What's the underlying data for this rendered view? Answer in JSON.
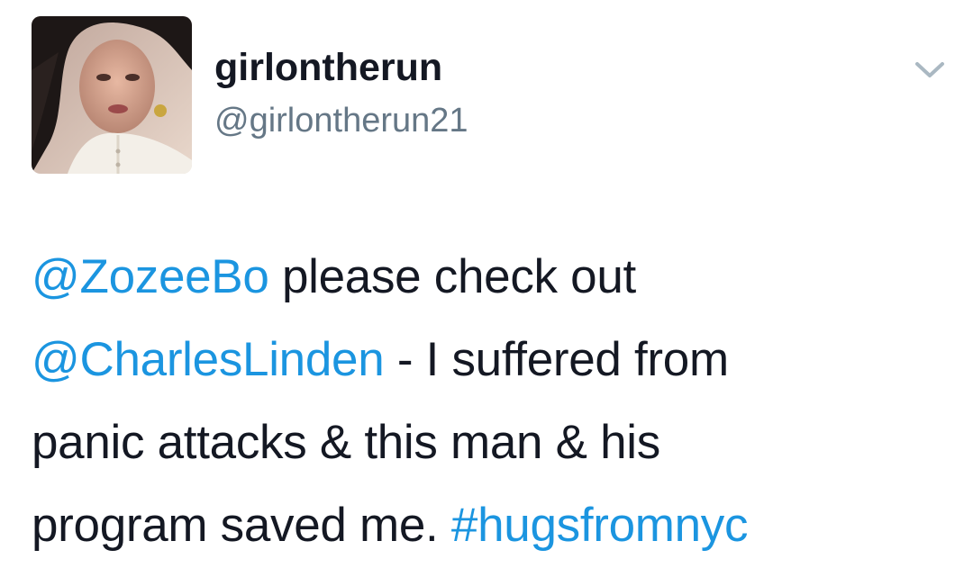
{
  "tweet": {
    "author": {
      "display_name": "girlontherun",
      "handle": "@girlontherun21",
      "avatar_icon": "profile-photo"
    },
    "menu_icon": "chevron-down-icon",
    "body": {
      "mention_1": "@ZozeeBo",
      "text_1": " please check out",
      "mention_2": "@CharlesLinden",
      "text_2": " - I suffered from",
      "text_3": "panic attacks & this man & his",
      "text_4": "program saved me. ",
      "hashtag": "#hugsfromnyc"
    }
  },
  "colors": {
    "link": "#1b95e0",
    "text": "#141823",
    "handle": "#657786",
    "background": "#ffffff"
  }
}
